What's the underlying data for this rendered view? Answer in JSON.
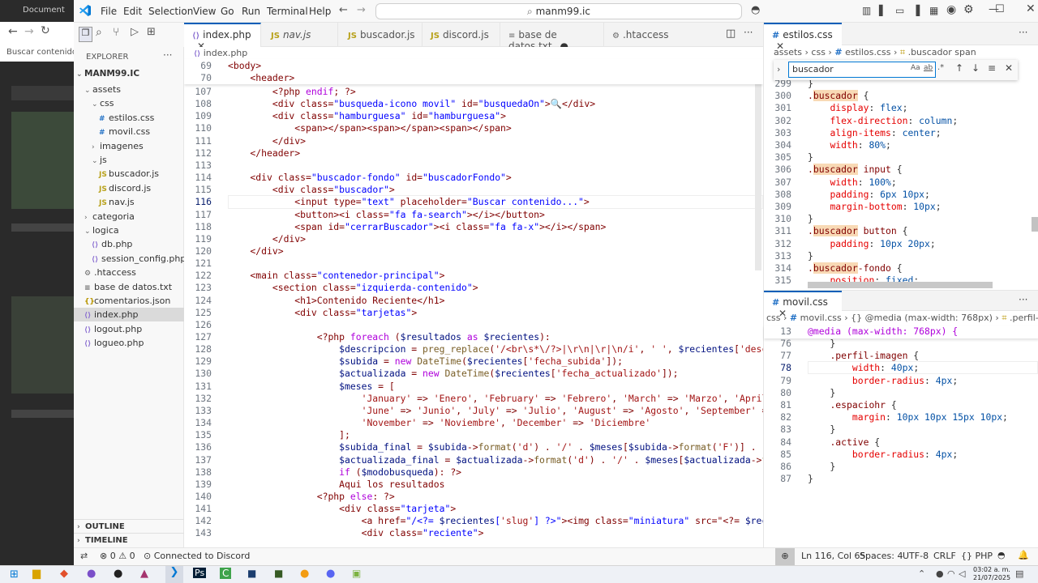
{
  "browser": {
    "tab_label": "Document",
    "address": "Buscar contenido..."
  },
  "titlebar": {
    "menus": [
      "File",
      "Edit",
      "Selection",
      "View",
      "Go",
      "Run",
      "Terminal",
      "Help"
    ],
    "command_center": "manm99.ic"
  },
  "sidebar": {
    "title": "EXPLORER",
    "root": "MANM99.IC",
    "items": [
      {
        "label": "assets",
        "depth": 1,
        "type": "folder-open"
      },
      {
        "label": "css",
        "depth": 2,
        "type": "folder-open"
      },
      {
        "label": "estilos.css",
        "depth": 3,
        "type": "css"
      },
      {
        "label": "movil.css",
        "depth": 3,
        "type": "css"
      },
      {
        "label": "imagenes",
        "depth": 2,
        "type": "folder"
      },
      {
        "label": "js",
        "depth": 2,
        "type": "folder-open"
      },
      {
        "label": "buscador.js",
        "depth": 3,
        "type": "js"
      },
      {
        "label": "discord.js",
        "depth": 3,
        "type": "js"
      },
      {
        "label": "nav.js",
        "depth": 3,
        "type": "js"
      },
      {
        "label": "categoria",
        "depth": 1,
        "type": "folder"
      },
      {
        "label": "logica",
        "depth": 1,
        "type": "folder-open"
      },
      {
        "label": "db.php",
        "depth": 2,
        "type": "php"
      },
      {
        "label": "session_config.php",
        "depth": 2,
        "type": "php"
      },
      {
        "label": ".htaccess",
        "depth": 1,
        "type": "gear"
      },
      {
        "label": "base de datos.txt",
        "depth": 1,
        "type": "txt"
      },
      {
        "label": "comentarios.json",
        "depth": 1,
        "type": "json"
      },
      {
        "label": "index.php",
        "depth": 1,
        "type": "php",
        "selected": true
      },
      {
        "label": "logout.php",
        "depth": 1,
        "type": "php"
      },
      {
        "label": "logueo.php",
        "depth": 1,
        "type": "php"
      }
    ],
    "outline": "OUTLINE",
    "timeline": "TIMELINE"
  },
  "tabs": [
    {
      "label": "index.php",
      "type": "php",
      "active": true
    },
    {
      "label": "nav.js",
      "type": "js"
    },
    {
      "label": "buscador.js",
      "type": "js"
    },
    {
      "label": "discord.js",
      "type": "js"
    },
    {
      "label": "base de datos.txt",
      "type": "txt",
      "dirty": true
    },
    {
      "label": ".htaccess",
      "type": "gear"
    }
  ],
  "editor": {
    "breadcrumb": "index.php",
    "sticky": [
      {
        "n": "69",
        "code": "<body>"
      },
      {
        "n": "70",
        "code": "    <header>"
      }
    ],
    "lines": [
      {
        "n": "107",
        "code": "        <?php endif; ?>"
      },
      {
        "n": "108",
        "code": "        <div class=\"busqueda-icono movil\" id=\"busquedaOn\">🔍</div>"
      },
      {
        "n": "109",
        "code": "        <div class=\"hamburguesa\" id=\"hamburguesa\">"
      },
      {
        "n": "110",
        "code": "            <span></span><span></span><span></span>"
      },
      {
        "n": "111",
        "code": "        </div>"
      },
      {
        "n": "112",
        "code": "    </header>"
      },
      {
        "n": "113",
        "code": ""
      },
      {
        "n": "114",
        "code": "    <div class=\"buscador-fondo\" id=\"buscadorFondo\">"
      },
      {
        "n": "115",
        "code": "        <div class=\"buscador\">"
      },
      {
        "n": "116",
        "code": "            <input type=\"text\" placeholder=\"Buscar contenido...\">"
      },
      {
        "n": "117",
        "code": "            <button><i class=\"fa fa-search\"></i></button>"
      },
      {
        "n": "118",
        "code": "            <span id=\"cerrarBuscador\"><i class=\"fa fa-x\"></i></span>"
      },
      {
        "n": "119",
        "code": "        </div>"
      },
      {
        "n": "120",
        "code": "    </div>"
      },
      {
        "n": "121",
        "code": ""
      },
      {
        "n": "122",
        "code": "    <main class=\"contenedor-principal\">"
      },
      {
        "n": "123",
        "code": "        <section class=\"izquierda-contenido\">"
      },
      {
        "n": "124",
        "code": "            <h1>Contenido Reciente</h1>"
      },
      {
        "n": "125",
        "code": "            <div class=\"tarjetas\">"
      },
      {
        "n": "126",
        "code": ""
      },
      {
        "n": "127",
        "code": "                <?php foreach ($resultados as $recientes):"
      },
      {
        "n": "128",
        "code": "                    $descripcion = preg_replace('/<br\\s*\\/?>|\\r\\n|\\r|\\n/i', ' ', $recientes['descripcion'])"
      },
      {
        "n": "129",
        "code": "                    $subida = new DateTime($recientes['fecha_subida']);"
      },
      {
        "n": "130",
        "code": "                    $actualizada = new DateTime($recientes['fecha_actualizado']);"
      },
      {
        "n": "131",
        "code": "                    $meses = ["
      },
      {
        "n": "132",
        "code": "                        'January' => 'Enero', 'February' => 'Febrero', 'March' => 'Marzo', 'April' => 'Abri"
      },
      {
        "n": "133",
        "code": "                        'June' => 'Junio', 'July' => 'Julio', 'August' => 'Agosto', 'September' => 'Septiem"
      },
      {
        "n": "134",
        "code": "                        'November' => 'Noviembre', 'December' => 'Diciembre'"
      },
      {
        "n": "135",
        "code": "                    ];"
      },
      {
        "n": "136",
        "code": "                    $subida_final = $subida->format('d') . '/' . $meses[$subida->format('F')] . '/' . $subi"
      },
      {
        "n": "137",
        "code": "                    $actualizada_final = $actualizada->format('d') . '/' . $meses[$actualizada->format('F')"
      },
      {
        "n": "138",
        "code": "                    if ($modobusqueda): ?>"
      },
      {
        "n": "139",
        "code": "                    Aqui los resultados"
      },
      {
        "n": "140",
        "code": "                <?php else: ?>"
      },
      {
        "n": "141",
        "code": "                    <div class=\"tarjeta\">"
      },
      {
        "n": "142",
        "code": "                        <a href=\"/<?= $recientes['slug'] ?>\"><img class=\"miniatura\" src=\"<?= $recientes['po"
      },
      {
        "n": "143",
        "code": "                        <div class=\"reciente\">"
      }
    ]
  },
  "right_top": {
    "tab": "estilos.css",
    "breadcrumb": [
      "assets",
      "css",
      "estilos.css",
      ".buscador span"
    ],
    "find_value": "buscador",
    "lines": [
      {
        "n": "299",
        "code": "}"
      },
      {
        "n": "300",
        "code": ".buscador {"
      },
      {
        "n": "301",
        "code": "    display: flex;"
      },
      {
        "n": "302",
        "code": "    flex-direction: column;"
      },
      {
        "n": "303",
        "code": "    align-items: center;"
      },
      {
        "n": "304",
        "code": "    width: 80%;"
      },
      {
        "n": "305",
        "code": "}"
      },
      {
        "n": "306",
        "code": ".buscador input {"
      },
      {
        "n": "307",
        "code": "    width: 100%;"
      },
      {
        "n": "308",
        "code": "    padding: 6px 10px;"
      },
      {
        "n": "309",
        "code": "    margin-bottom: 10px;"
      },
      {
        "n": "310",
        "code": "}"
      },
      {
        "n": "311",
        "code": ".buscador button {"
      },
      {
        "n": "312",
        "code": "    padding: 10px 20px;"
      },
      {
        "n": "313",
        "code": "}"
      },
      {
        "n": "314",
        "code": ".buscador-fondo {"
      },
      {
        "n": "315",
        "code": "    position: fixed;"
      }
    ]
  },
  "right_bottom": {
    "tab": "movil.css",
    "breadcrumb": [
      "css",
      "movil.css",
      "{} @media (max-width: 768px)",
      ".perfil-imagen"
    ],
    "sticky": {
      "n": "13",
      "code": "@media (max-width: 768px) {"
    },
    "lines": [
      {
        "n": "76",
        "code": "    }"
      },
      {
        "n": "77",
        "code": "    .perfil-imagen {"
      },
      {
        "n": "78",
        "code": "        width: 40px;"
      },
      {
        "n": "79",
        "code": "        border-radius: 4px;"
      },
      {
        "n": "80",
        "code": "    }"
      },
      {
        "n": "81",
        "code": "    .espaciohr {"
      },
      {
        "n": "82",
        "code": "        margin: 10px 10px 15px 10px;"
      },
      {
        "n": "83",
        "code": "    }"
      },
      {
        "n": "84",
        "code": "    .active {"
      },
      {
        "n": "85",
        "code": "        border-radius: 4px;"
      },
      {
        "n": "86",
        "code": "    }"
      },
      {
        "n": "87",
        "code": "}"
      }
    ]
  },
  "status": {
    "errors": "0",
    "warnings": "0",
    "discord": "Connected to Discord",
    "position": "Ln 116, Col 65",
    "spaces": "Spaces: 4",
    "encoding": "UTF-8",
    "eol": "CRLF",
    "language": "PHP"
  },
  "taskbar": {
    "time": "03:02 a. m.",
    "date": "21/07/2025"
  }
}
